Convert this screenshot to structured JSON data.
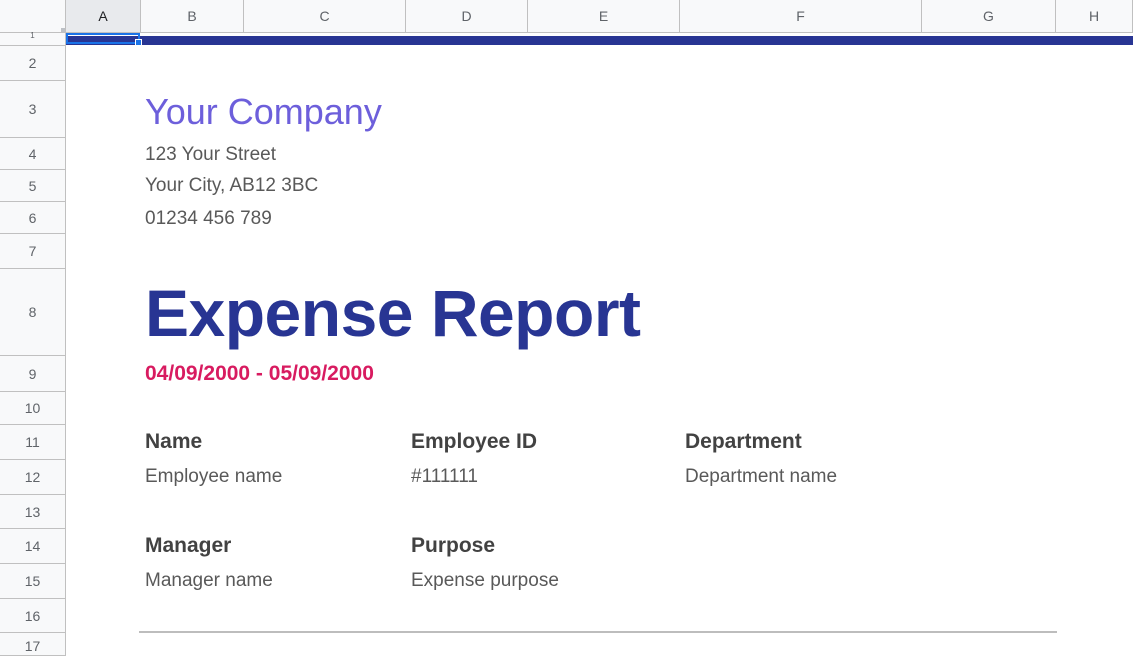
{
  "spreadsheet": {
    "columns": [
      "A",
      "B",
      "C",
      "D",
      "E",
      "F",
      "G",
      "H"
    ],
    "rows": [
      "1",
      "2",
      "3",
      "4",
      "5",
      "6",
      "7",
      "8",
      "9",
      "10",
      "11",
      "12",
      "13",
      "14",
      "15",
      "16",
      "17"
    ],
    "selected_cell": "A1"
  },
  "colors": {
    "accent_bar": "#283593",
    "company_name": "#6d5fdb",
    "title": "#283593",
    "date_range": "#d81b60",
    "selection": "#1a73e8"
  },
  "company": {
    "name": "Your Company",
    "street": "123 Your Street",
    "city": "Your City, AB12 3BC",
    "phone": "01234 456 789"
  },
  "report": {
    "title": "Expense Report",
    "date_range": "04/09/2000 - 05/09/2000"
  },
  "fields": {
    "name": {
      "label": "Name",
      "value": "Employee name"
    },
    "employee_id": {
      "label": "Employee ID",
      "value": "#111111"
    },
    "department": {
      "label": "Department",
      "value": "Department name"
    },
    "manager": {
      "label": "Manager",
      "value": "Manager name"
    },
    "purpose": {
      "label": "Purpose",
      "value": "Expense purpose"
    }
  }
}
